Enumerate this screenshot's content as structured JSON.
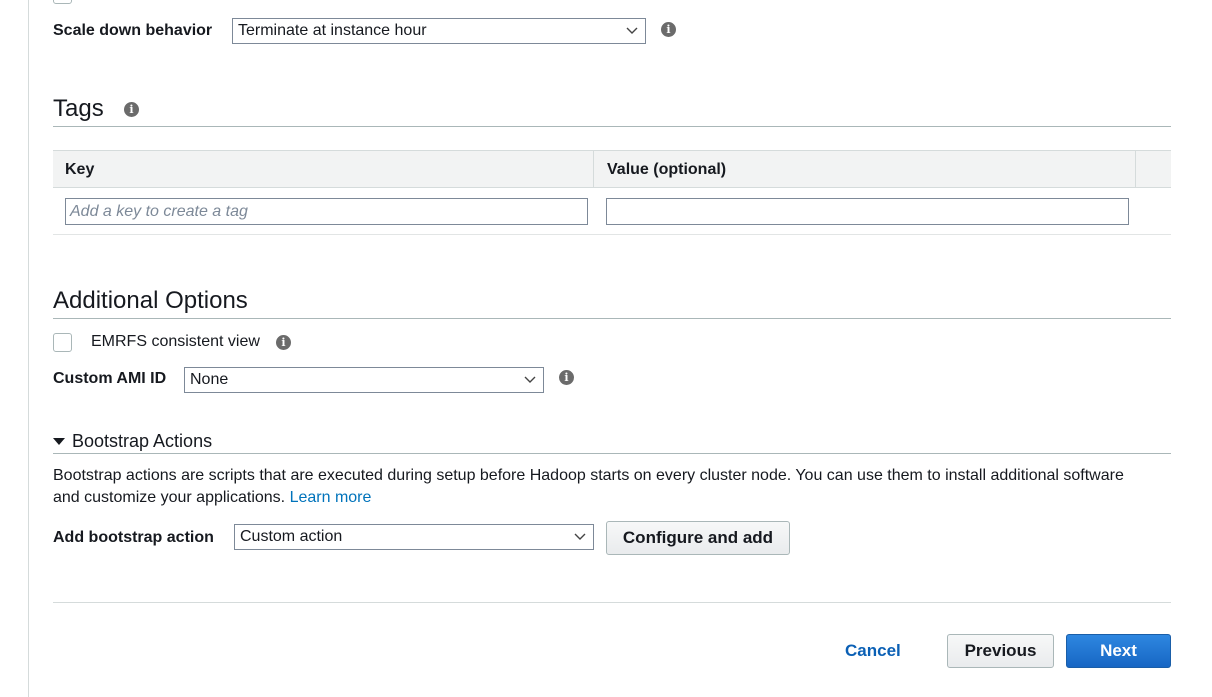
{
  "scale_down": {
    "label": "Scale down behavior",
    "value": "Terminate at instance hour"
  },
  "tags": {
    "title": "Tags",
    "columns": [
      "Key",
      "Value (optional)"
    ],
    "key_placeholder": "Add a key to create a tag",
    "value_input": ""
  },
  "additional_options": {
    "title": "Additional Options",
    "emrfs_label": "EMRFS consistent view",
    "emrfs_checked": false,
    "ami_label": "Custom AMI ID",
    "ami_value": "None"
  },
  "bootstrap": {
    "title": "Bootstrap Actions",
    "expanded": true,
    "description": "Bootstrap actions are scripts that are executed during setup before Hadoop starts on every cluster node. You can use them to install additional software and customize your applications.",
    "learn_more": "Learn more",
    "add_label": "Add bootstrap action",
    "add_value": "Custom action",
    "configure_button": "Configure and add"
  },
  "footer": {
    "cancel": "Cancel",
    "previous": "Previous",
    "next": "Next"
  },
  "icons": {
    "info": "info-icon",
    "dropdown": "chevron-down-icon",
    "expand": "caret-down-icon"
  },
  "colors": {
    "link": "#0073bb",
    "primary_button": "#1766c4",
    "divider": "#aab7b8"
  }
}
